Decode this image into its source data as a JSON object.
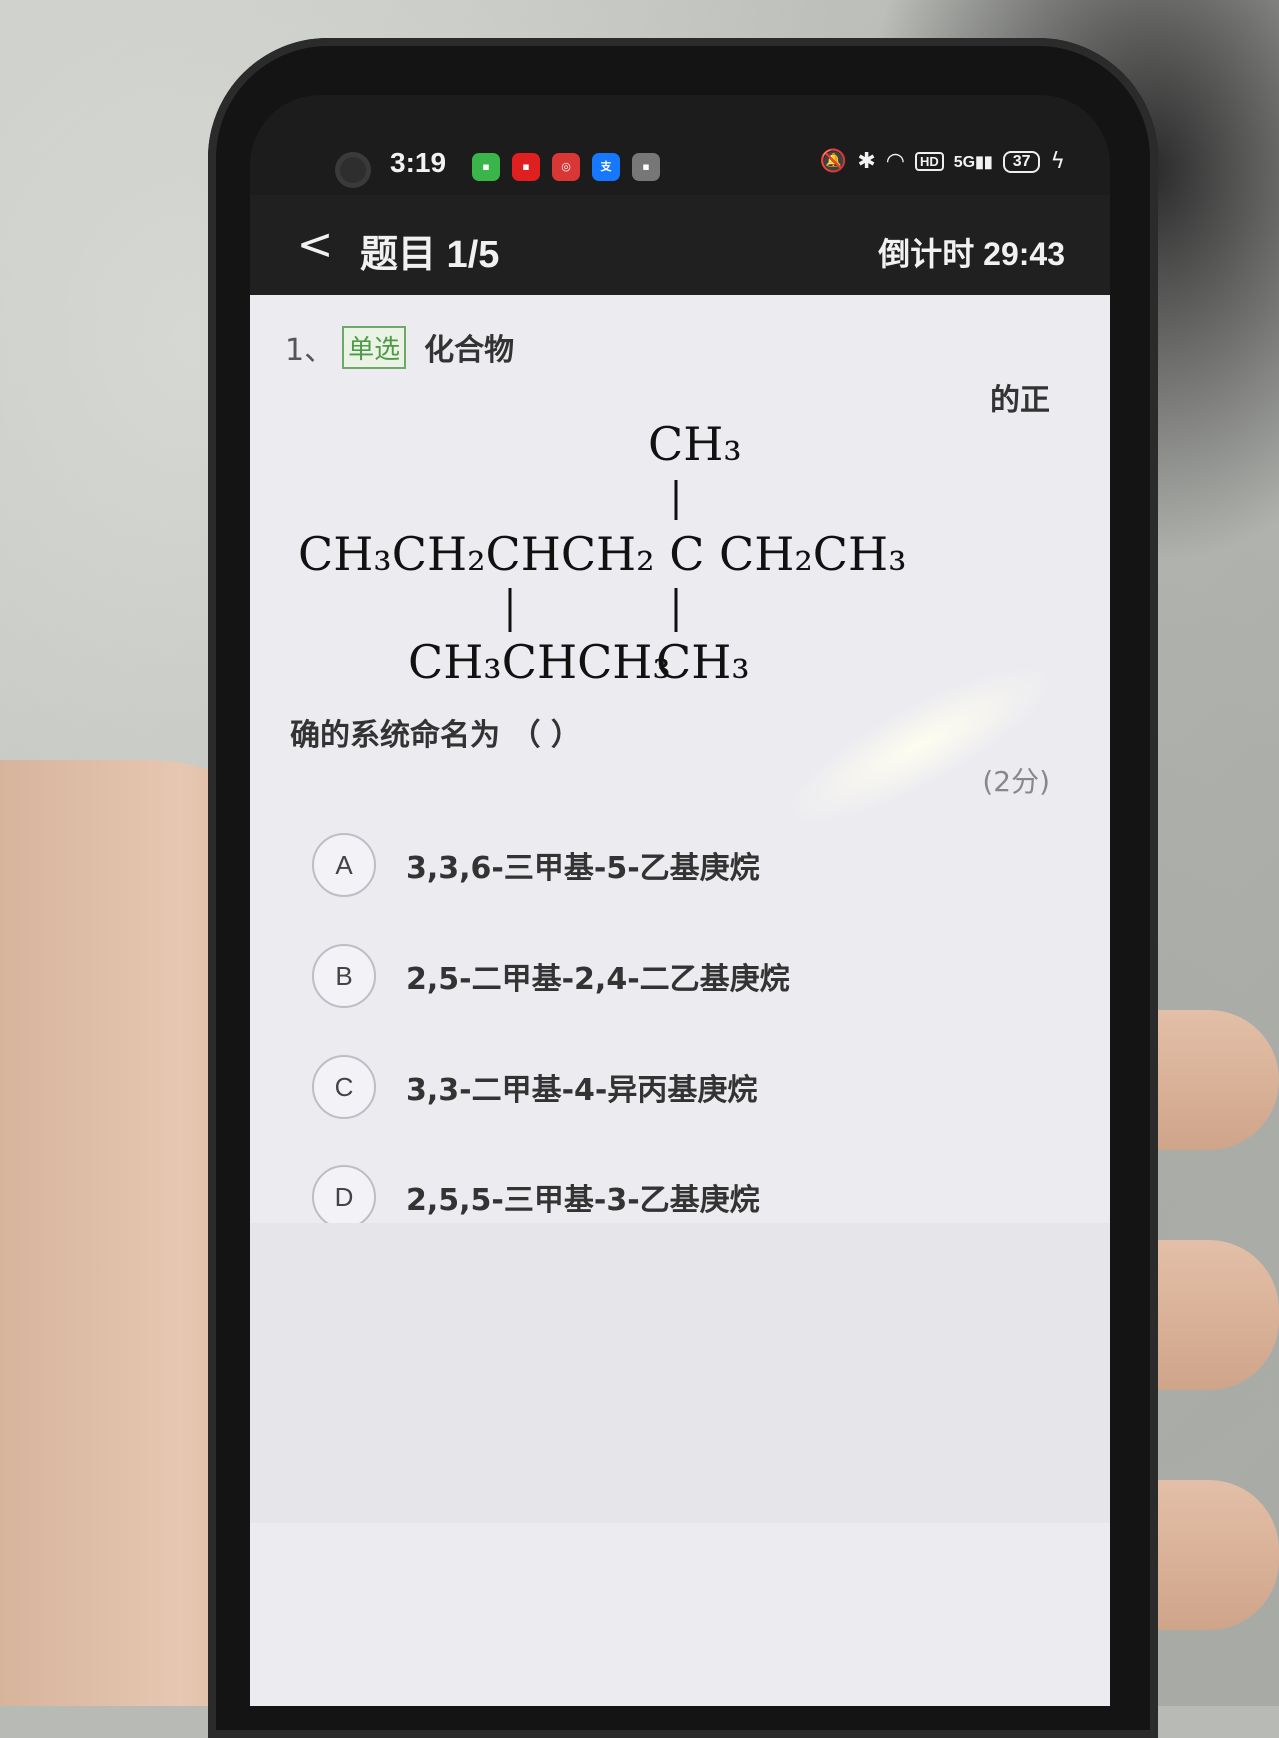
{
  "status_bar": {
    "time": "3:19",
    "network": "5G",
    "hd": "HD",
    "battery": "37"
  },
  "nav": {
    "back_symbol": "<",
    "title": "题目 1/5",
    "countdown": "倒计时 29:43"
  },
  "question": {
    "index": "1、",
    "type": "单选",
    "text_start": "化合物",
    "text_cont": "的正",
    "text_end": "确的系统命名为 （    ）",
    "score": "(2分)",
    "formula": {
      "top_branch": "CH₃",
      "main_chain": "CH₃CH₂CHCH₂ C CH₂CH₃",
      "bottom_branch_left": "CH₃CHCH₃",
      "bottom_branch_right": "CH₃"
    }
  },
  "options": [
    {
      "letter": "A",
      "text": "3,3,6-三甲基-5-乙基庚烷"
    },
    {
      "letter": "B",
      "text": "2,5-二甲基-2,4-二乙基庚烷"
    },
    {
      "letter": "C",
      "text": "3,3-二甲基-4-异丙基庚烷"
    },
    {
      "letter": "D",
      "text": "2,5,5-三甲基-3-乙基庚烷"
    }
  ],
  "icons": [
    "camera-icon",
    "wechat-icon",
    "app-icon-red",
    "app-icon-target",
    "alipay-icon",
    "app-icon-gray",
    "mute-icon",
    "bluetooth-icon",
    "wifi-icon",
    "signal-icon",
    "charging-icon",
    "back-icon"
  ]
}
